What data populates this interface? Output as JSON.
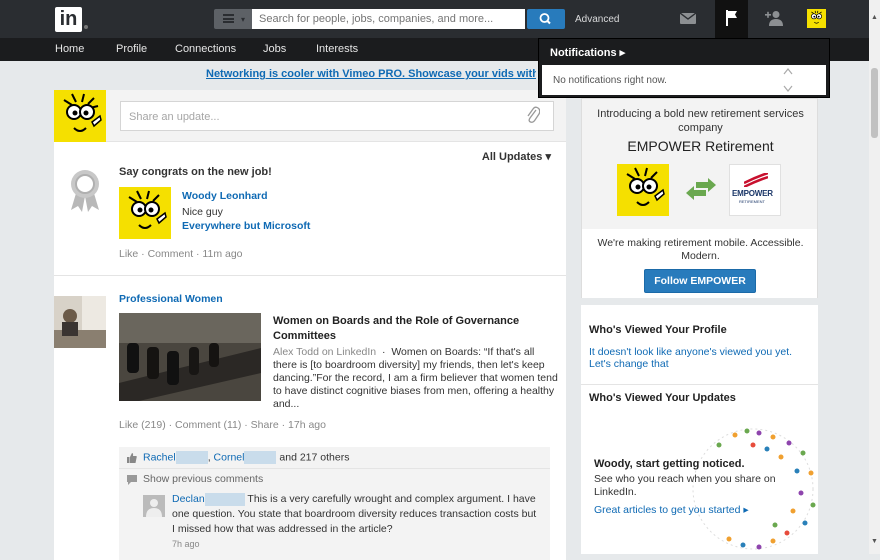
{
  "header": {
    "logo_text": "in",
    "search_placeholder": "Search for people, jobs, companies, and more...",
    "advanced_label": "Advanced"
  },
  "nav": {
    "items": [
      "Home",
      "Profile",
      "Connections",
      "Jobs",
      "Interests"
    ]
  },
  "promo": {
    "text": "Networking is cooler with Vimeo PRO. Showcase your vids with up"
  },
  "notifications": {
    "title": "Notifications ▸",
    "empty_text": "No notifications right now."
  },
  "share": {
    "placeholder": "Share an update..."
  },
  "feed": {
    "filter_label": "All Updates ▾",
    "congrats": {
      "heading": "Say congrats on the new job!",
      "name": "Woody Leonhard",
      "headline": "Nice guy",
      "company": "Everywhere but Microsoft",
      "actions": "Like  ·  Comment  ·  11m ago"
    },
    "post": {
      "group": "Professional Women",
      "title": "Women on Boards and the Role of Governance Committees",
      "source": "Alex Todd on LinkedIn",
      "body": "Women on Boards: “If that's all there is [to boardroom diversity] my friends, then let's keep dancing.”For the record, I am a firm believer that women tend to have distinct cognitive biases from men, offering a healthy and...",
      "actions": "Like (219)  ·  Comment (11)  ·  Share  ·  17h ago",
      "likers": {
        "name1": "Rachel",
        "name2": "Cornel",
        "others": "and 217 others"
      },
      "show_previous": "Show previous comments",
      "comment": {
        "author": "Declan",
        "text": "This is a very carefully wrought and complex argument. I have one question. You state that boardroom diversity reduces transaction costs but I missed how that was addressed in the article?",
        "time": "7h ago"
      }
    }
  },
  "sidebar": {
    "ad": {
      "intro": "Introducing a bold new retirement services company",
      "company": "EMPOWER Retirement",
      "logo_text": "EMPOWER",
      "logo_sub": "RETIREMENT",
      "tagline": "We're making retirement mobile. Accessible. Modern.",
      "follow_label": "Follow EMPOWER"
    },
    "viewed_profile": {
      "heading": "Who's Viewed Your Profile",
      "link": "It doesn't look like anyone's viewed you yet. Let's change that"
    },
    "viewed_updates": {
      "heading": "Who's Viewed Your Updates",
      "title": "Woody, start getting noticed.",
      "text": "See who you reach when you share on LinkedIn.",
      "link": "Great articles to get you started ▸"
    }
  },
  "colors": {
    "topbar": "#2a2d31",
    "navbar": "#1b1c1e",
    "accent_blue": "#287bbc",
    "link_blue": "#0f6ab4",
    "avatar_yellow": "#f5e000"
  }
}
